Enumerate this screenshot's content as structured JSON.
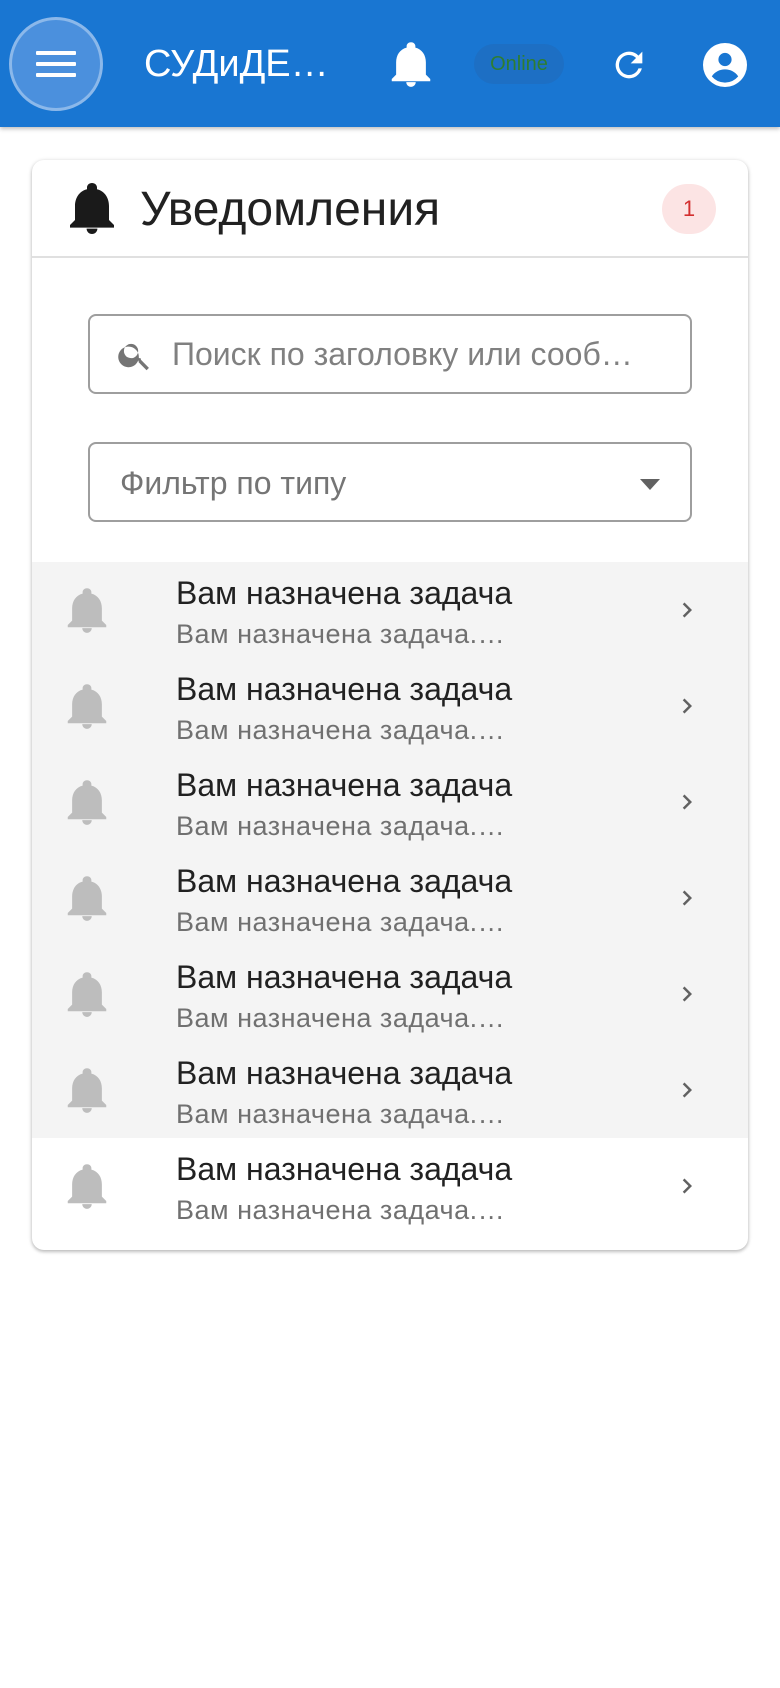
{
  "appbar": {
    "title": "СУДиДЕ…",
    "menu_icon": "menu-icon",
    "notifications_icon": "bell-icon",
    "status_label": "Online",
    "refresh_icon": "refresh-icon",
    "account_icon": "account-circle-icon",
    "background_color": "#1976d2"
  },
  "notifications_card": {
    "title": "Уведомления",
    "header_icon": "bell-icon",
    "unread_count": "1",
    "search": {
      "placeholder": "Поиск по заголовку или сооб…",
      "value": ""
    },
    "filter": {
      "placeholder": "Фильтр по типу",
      "selected": ""
    },
    "items": [
      {
        "title": "Вам назначена задача",
        "message": "Вам назначена задача.…",
        "state": "unread"
      },
      {
        "title": "Вам назначена задача",
        "message": "Вам назначена задача.…",
        "state": "unread"
      },
      {
        "title": "Вам назначена задача",
        "message": "Вам назначена задача.…",
        "state": "unread"
      },
      {
        "title": "Вам назначена задача",
        "message": "Вам назначена задача.…",
        "state": "unread"
      },
      {
        "title": "Вам назначена задача",
        "message": "Вам назначена задача.…",
        "state": "unread"
      },
      {
        "title": "Вам назначена задача",
        "message": "Вам назначена задача.…",
        "state": "unread"
      },
      {
        "title": "Вам назначена задача",
        "message": "Вам назначена задача.…",
        "state": "read"
      }
    ]
  },
  "colors": {
    "accent": "#1976d2",
    "unread_row": "#f4f4f4",
    "badge_text": "#d32f2f",
    "badge_bg": "#fce4e4",
    "status_text": "#2e7d32"
  }
}
